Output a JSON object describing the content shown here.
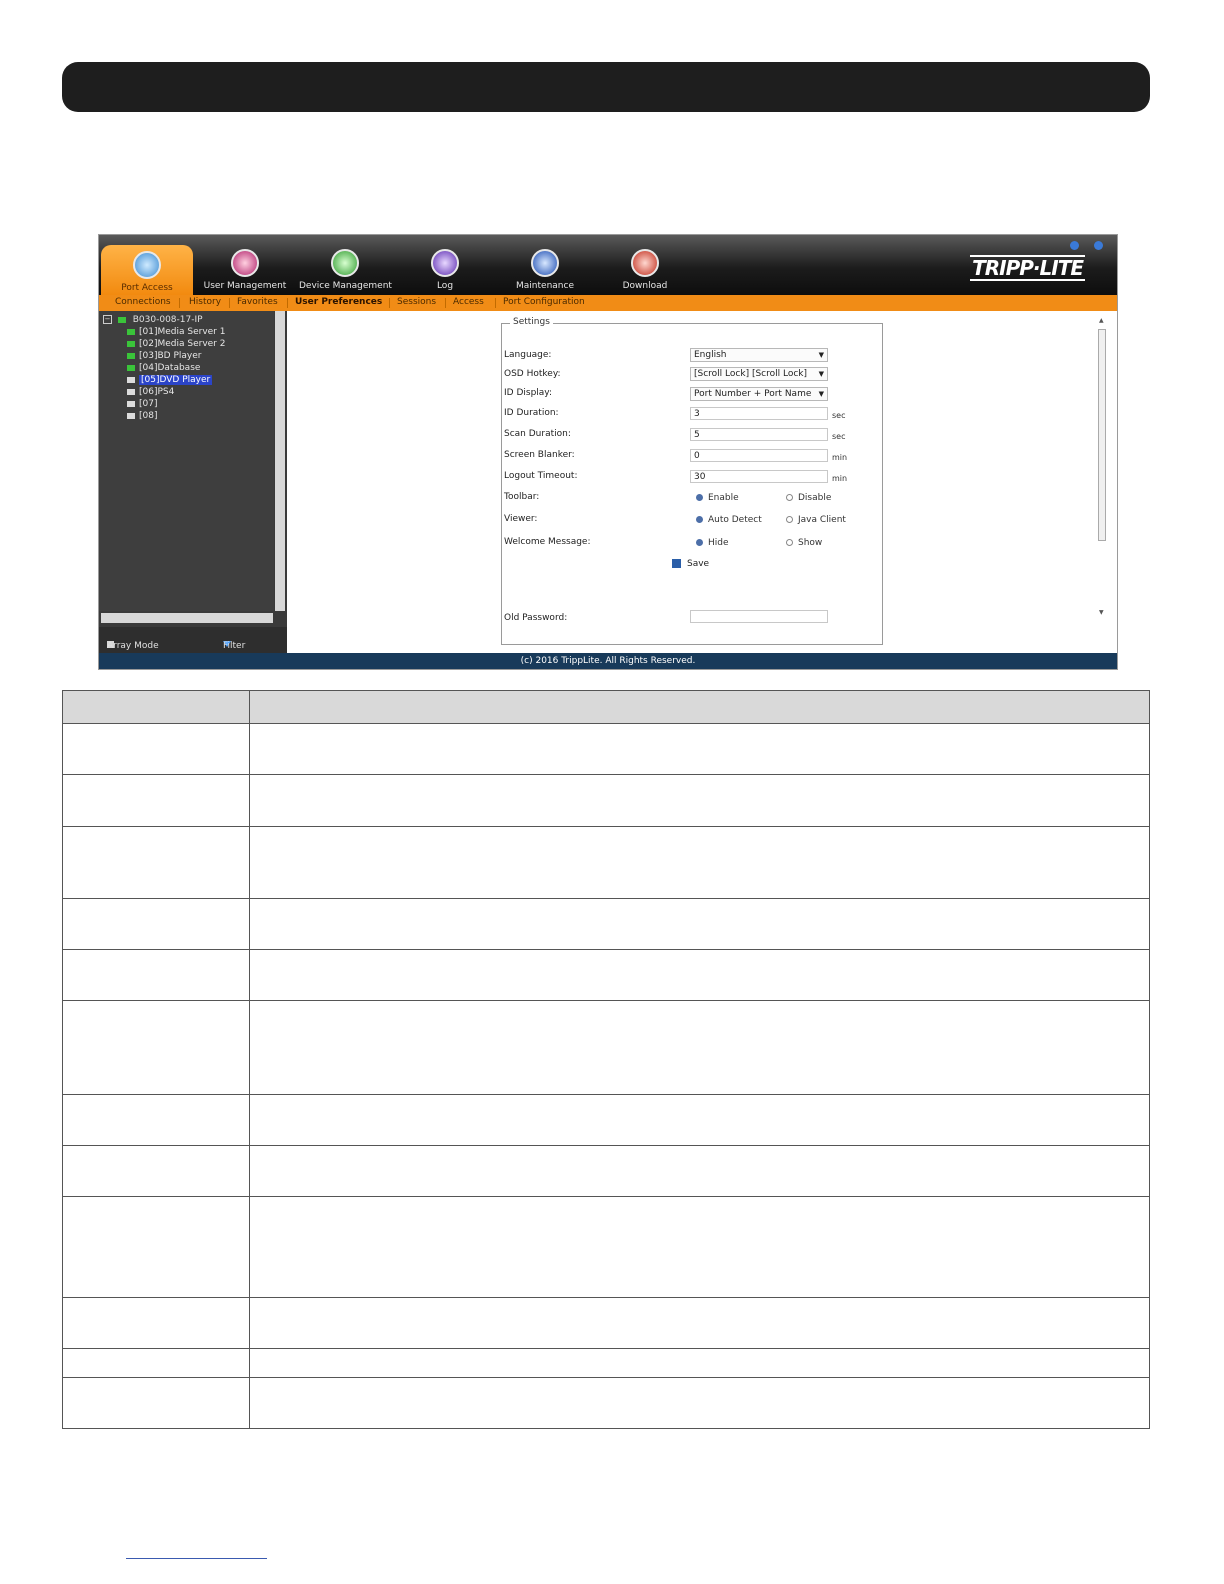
{
  "app": {
    "nav_tabs": [
      {
        "label": "Port Access",
        "icon": "port-access-icon",
        "active": true
      },
      {
        "label": "User Management",
        "icon": "user-management-icon",
        "active": false
      },
      {
        "label": "Device Management",
        "icon": "device-management-icon",
        "active": false
      },
      {
        "label": "Log",
        "icon": "log-icon",
        "active": false
      },
      {
        "label": "Maintenance",
        "icon": "maintenance-icon",
        "active": false
      },
      {
        "label": "Download",
        "icon": "download-icon",
        "active": false
      }
    ],
    "logo": "TRIPP·LITE",
    "sub_tabs": [
      "Connections",
      "History",
      "Favorites",
      "User Preferences",
      "Sessions",
      "Access",
      "Port Configuration"
    ],
    "active_sub_tab": "User Preferences",
    "tree": {
      "root": "B030-008-17-IP",
      "items": [
        {
          "label": "[01]Media Server 1",
          "online": true
        },
        {
          "label": "[02]Media Server 2",
          "online": true
        },
        {
          "label": "[03]BD Player",
          "online": true
        },
        {
          "label": "[04]Database",
          "online": true
        },
        {
          "label": "[05]DVD Player",
          "online": false,
          "selected": true
        },
        {
          "label": "[06]PS4",
          "online": false
        },
        {
          "label": "[07]",
          "online": false
        },
        {
          "label": "[08]",
          "online": false
        }
      ]
    },
    "sidebar_footer": {
      "array_mode": "Array Mode",
      "filter": "Filter"
    },
    "settings": {
      "legend": "Settings",
      "language": {
        "label": "Language:",
        "value": "English"
      },
      "osd_hotkey": {
        "label": "OSD Hotkey:",
        "value": "[Scroll Lock] [Scroll Lock]"
      },
      "id_display": {
        "label": "ID Display:",
        "value": "Port Number + Port Name"
      },
      "id_duration": {
        "label": "ID Duration:",
        "value": "3",
        "unit": "sec"
      },
      "scan_duration": {
        "label": "Scan Duration:",
        "value": "5",
        "unit": "sec"
      },
      "screen_blanker": {
        "label": "Screen Blanker:",
        "value": "0",
        "unit": "min"
      },
      "logout_timeout": {
        "label": "Logout Timeout:",
        "value": "30",
        "unit": "min"
      },
      "toolbar": {
        "label": "Toolbar:",
        "opt1": "Enable",
        "opt2": "Disable",
        "selected": "Enable"
      },
      "viewer": {
        "label": "Viewer:",
        "opt1": "Auto Detect",
        "opt2": "Java Client",
        "selected": "Auto Detect"
      },
      "welcome": {
        "label": "Welcome Message:",
        "opt1": "Hide",
        "opt2": "Show",
        "selected": "Hide"
      },
      "save": "Save",
      "old_password": {
        "label": "Old Password:",
        "value": ""
      }
    },
    "footer": "(c) 2016 TrippLite. All Rights Reserved."
  },
  "colors": {
    "accent_orange": "#f18c16",
    "footer_blue": "#183a5a",
    "selection_blue": "#2b44c8"
  }
}
